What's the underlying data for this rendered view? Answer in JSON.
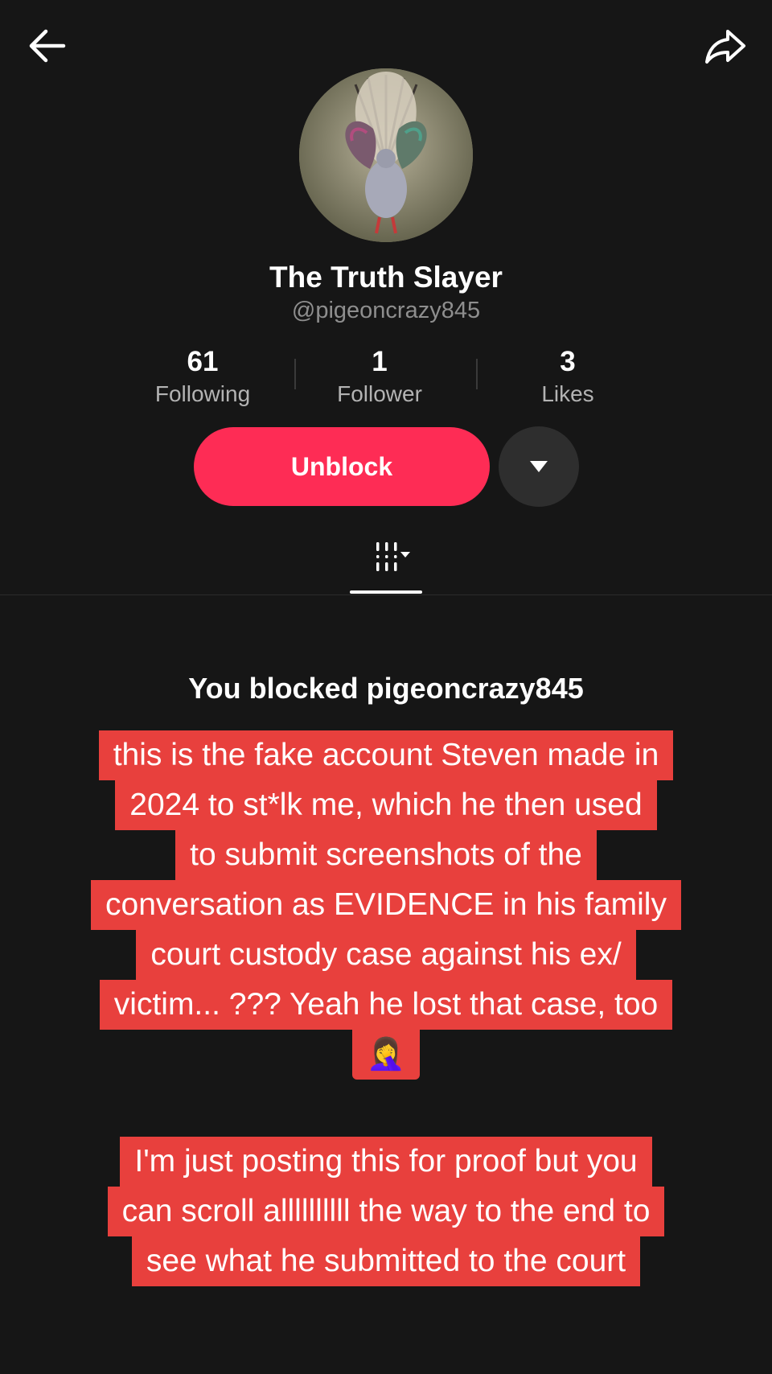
{
  "header": {
    "back_icon": "arrow-left-icon",
    "share_icon": "share-arrow-icon"
  },
  "profile": {
    "display_name": "The Truth Slayer",
    "handle": "@pigeoncrazy845",
    "avatar": "pigeon-photo"
  },
  "stats": [
    {
      "value": "61",
      "label": "Following"
    },
    {
      "value": "1",
      "label": "Follower"
    },
    {
      "value": "3",
      "label": "Likes"
    }
  ],
  "actions": {
    "unblock_label": "Unblock",
    "more_icon": "caret-down-icon"
  },
  "tabs": {
    "grid_icon": "grid-filter-icon"
  },
  "blocked_message": "You blocked pigeoncrazy845",
  "overlay": {
    "caption1_lines": [
      "this is the fake account Steven made in",
      "2024 to st*lk me, which he then used",
      "to submit screenshots of the",
      "conversation as EVIDENCE in his family",
      "court custody case against his ex/",
      "victim... ??? Yeah he lost that case, too"
    ],
    "caption1_emoji": "🤦‍♀️",
    "caption2_lines": [
      "I'm just posting this for proof but you",
      "can scroll allllllllll the way to the end to",
      "see what he submitted to the court"
    ]
  },
  "colors": {
    "background": "#161616",
    "accent": "#fe2c55",
    "caption_bg": "#e8403d"
  }
}
